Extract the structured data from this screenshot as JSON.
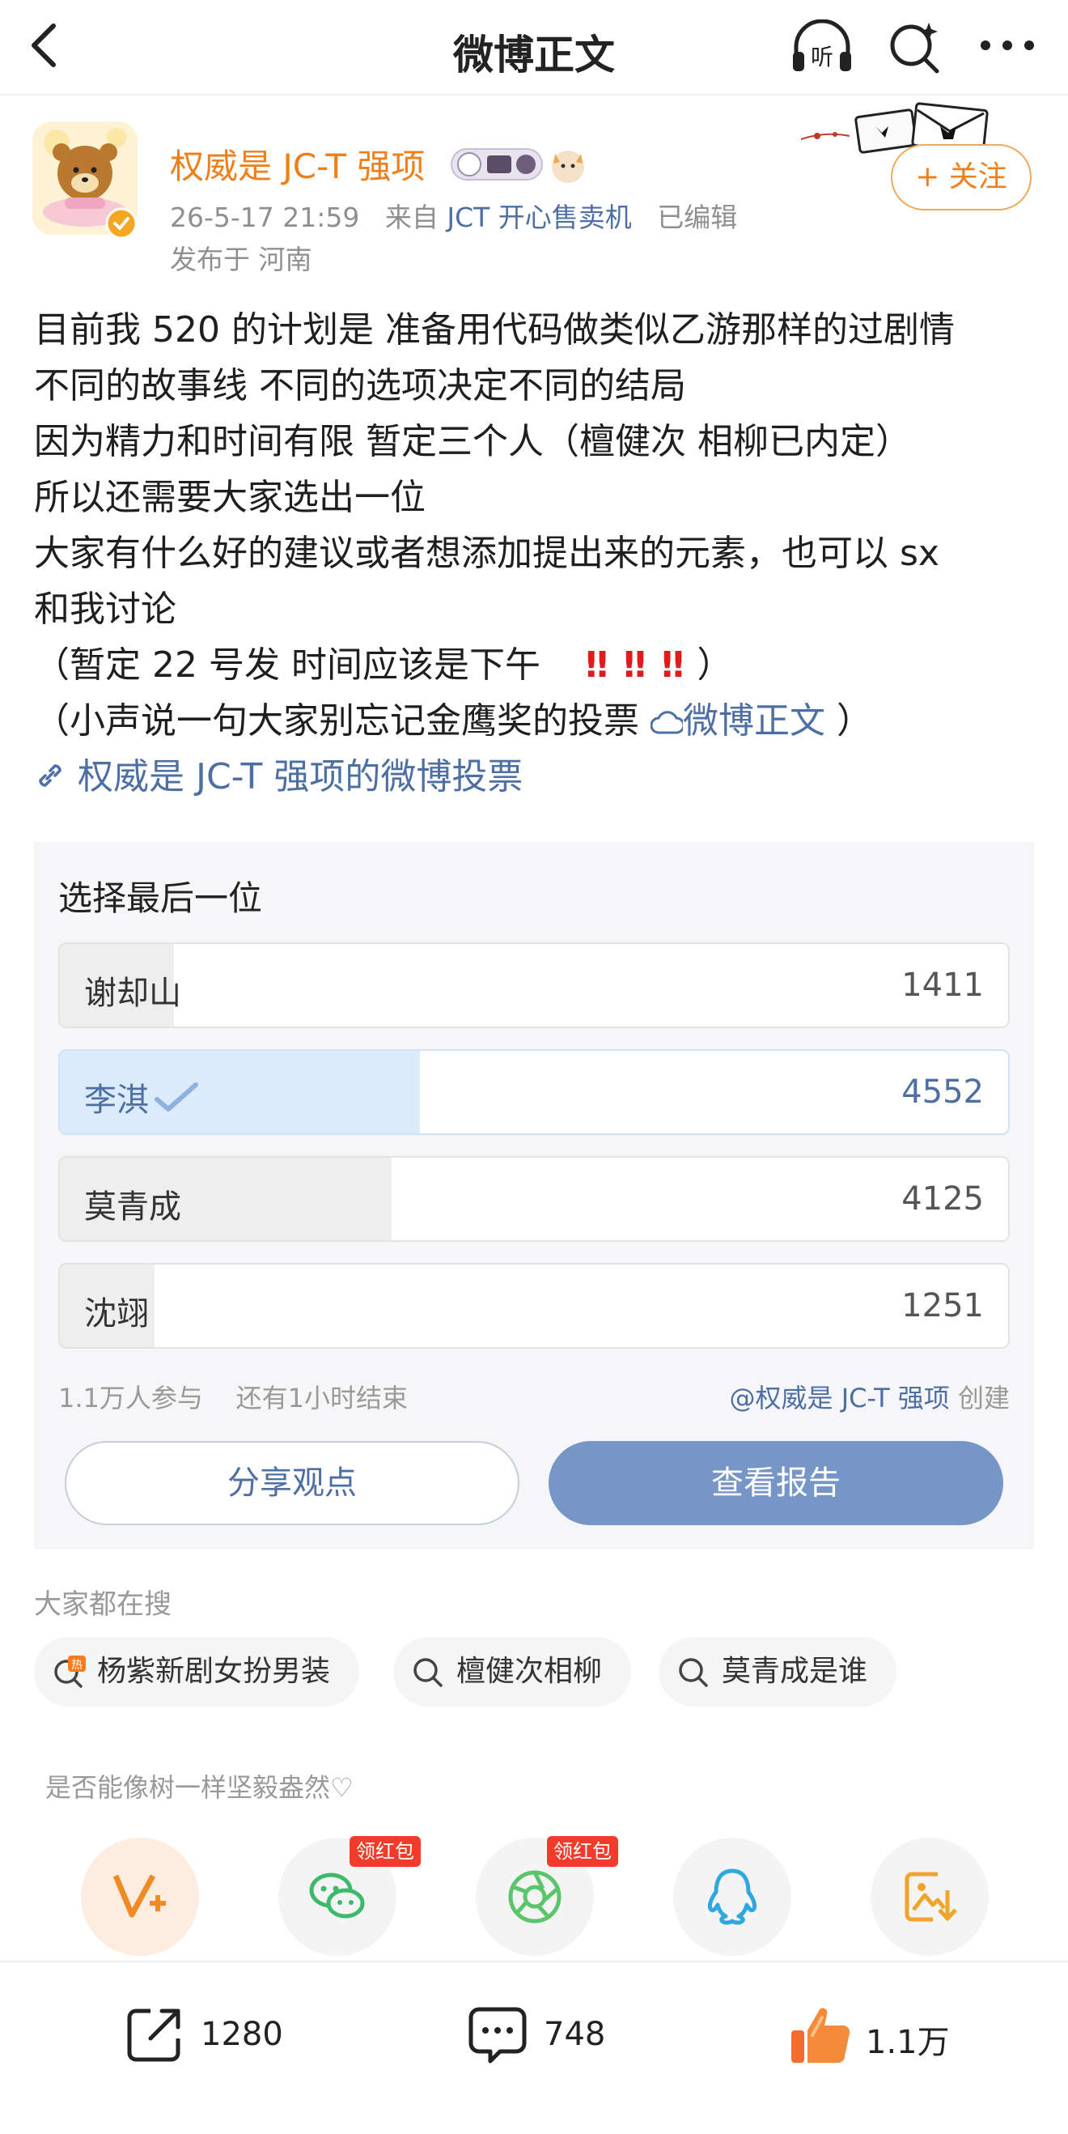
{
  "nav": {
    "title": "微博正文",
    "listen_label": "听"
  },
  "author": {
    "name": "权威是 JC-T 强项",
    "date": "26-5-17 21:59",
    "from_prefix": "来自",
    "source": "JCT 开心售卖机",
    "edited": "已编辑",
    "location": "发布于 河南",
    "follow_label": "+ 关注"
  },
  "post": {
    "line1": "目前我 520 的计划是 准备用代码做类似乙游那样的过剧情",
    "line2": "不同的故事线 不同的选项决定不同的结局",
    "line3": "因为精力和时间有限 暂定三个人（檀健次 相柳已内定）",
    "line4": "所以还需要大家选出一位",
    "line5": "大家有什么好的建议或者想添加提出来的元素，也可以 sx",
    "line6": "和我讨论",
    "line7_text": "（暂定 22 号发 时间应该是下午",
    "line7_marks": "‼ ‼ ‼",
    "line7_close": "）",
    "line8_text": "（小声说一句大家别忘记金鹰奖的投票",
    "line8_link": "微博正文",
    "line8_close": "）",
    "vote_link": "权威是 JC-T 强项的微博投票"
  },
  "poll": {
    "title": "选择最后一位",
    "options": [
      {
        "label": "谢却山",
        "count": "1411",
        "share": 0.12
      },
      {
        "label": "李淇",
        "count": "4552",
        "share": 0.38
      },
      {
        "label": "莫青成",
        "count": "4125",
        "share": 0.35
      },
      {
        "label": "沈翊",
        "count": "1251",
        "share": 0.1
      }
    ],
    "participants": "1.1万人参与",
    "remaining": "还有1小时结束",
    "creator": "@权威是 JC-T 强项",
    "creator_suffix": "创建",
    "share_label": "分享观点",
    "report_label": "查看报告"
  },
  "search": {
    "title": "大家都在搜",
    "chips": [
      "杨紫新剧女扮男装",
      "檀健次相柳",
      "莫青成是谁"
    ],
    "hot_mark": "热"
  },
  "share_row": {
    "tagline": "是否能像树一样坚毅盎然♡",
    "redpack_label": "领红包"
  },
  "bottom_bar": {
    "repost_count": "1280",
    "comment_count": "748",
    "like_count": "1.1万"
  },
  "colors": {
    "accent_orange": "#ee7f1a",
    "link_blue": "#4d6fa3",
    "report_button": "#7696c8",
    "selected_fill": "#dcebfa",
    "exclamation_red": "#e01b1b"
  }
}
